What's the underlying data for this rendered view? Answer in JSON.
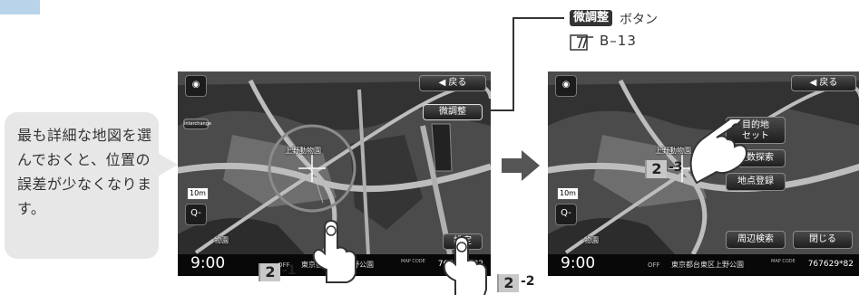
{
  "callout": {
    "text": "最も詳細な地図を選んでおくと、位置の誤差が少なくなります。"
  },
  "annotation": {
    "badge_label": "微調整",
    "badge_suffix": "ボタン",
    "reference": "B–13"
  },
  "steps": [
    {
      "number": "2",
      "suffix": "-1"
    },
    {
      "number": "2",
      "suffix": "-2"
    },
    {
      "number": "2",
      "suffix": "-3"
    }
  ],
  "left_screen": {
    "back_button": "◀ 戻る",
    "fine_adjust_button": "微調整",
    "set_button": "設定",
    "scale_value": "10m",
    "zoom_out": "Q-",
    "park_label": "上野動物園",
    "poi_label": "物園",
    "status": {
      "time": "9:00",
      "off": "OFF",
      "address": "東京都台東区上野公園",
      "mapcode_tag": "MAP CODE",
      "code": "767629*82"
    }
  },
  "right_screen": {
    "back_button": "◀ 戻る",
    "menu": [
      "目的地\nセット",
      "複数探索",
      "地点登録",
      "周辺検索",
      "閉じる"
    ],
    "scale_value": "10m",
    "zoom_out": "Q-",
    "park_label": "上野動物園",
    "poi_label": "物園",
    "status": {
      "time": "9:00",
      "off": "OFF",
      "address": "東京都台東区上野公園",
      "mapcode_tag": "MAP CODE",
      "code": "767629*82"
    }
  },
  "colors": {
    "step_box": "#c8c8c8",
    "callout": "#e7e7e7",
    "arrow": "#555555",
    "map_base": "#4b4b4b",
    "road": "#bdbdbd"
  }
}
